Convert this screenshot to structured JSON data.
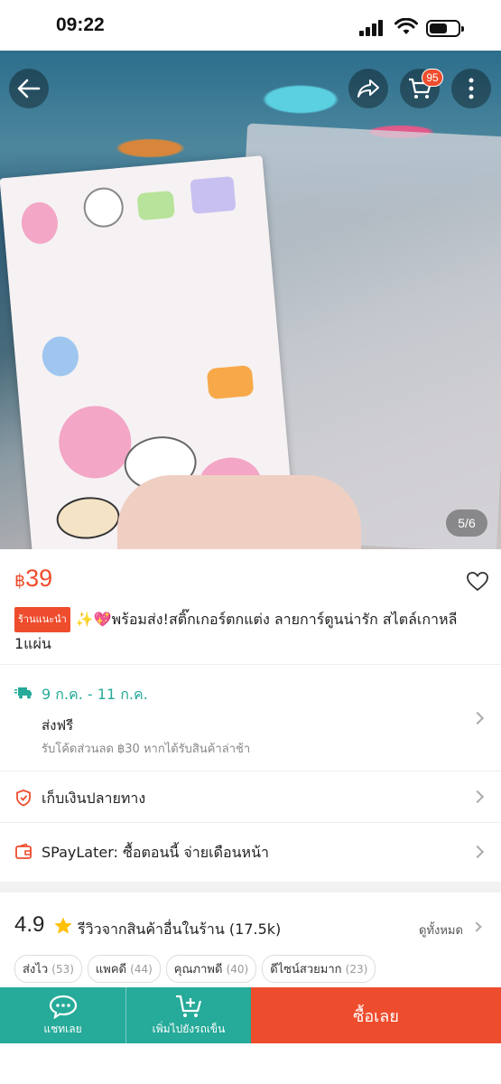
{
  "status_bar": {
    "time": "09:22"
  },
  "hero": {
    "cart_count": "95",
    "counter": "5/6"
  },
  "product": {
    "currency": "฿",
    "price": "39",
    "badge": "ร้านแนะนำ",
    "title": "✨💖พร้อมส่ง!สติ๊กเกอร์ตกแต่ง ลายการ์ตูนน่ารัก สไตล์เกาหลี 1แผ่น"
  },
  "shipping": {
    "date": "9 ก.ค. - 11 ก.ค.",
    "free_label": "ส่งฟรี",
    "note": "รับโค้ดส่วนลด ฿30 หากได้รับสินค้าล่าช้า"
  },
  "payment": {
    "cod": "เก็บเงินปลายทาง",
    "spaylater": "SPayLater: ซื้อตอนนี้ จ่ายเดือนหน้า"
  },
  "reviews": {
    "rating": "4.9",
    "label": "รีวิวจากสินค้าอื่นในร้าน",
    "count": "(17.5k)",
    "see_all": "ดูทั้งหมด",
    "chips": [
      {
        "label": "ส่งไว",
        "count": "(53)"
      },
      {
        "label": "แพคดี",
        "count": "(44)"
      },
      {
        "label": "คุณภาพดี",
        "count": "(40)"
      },
      {
        "label": "ดีไซน์สวยมาก",
        "count": "(23)"
      }
    ]
  },
  "bottom_bar": {
    "chat_label": "แชทเลย",
    "cart_label": "เพิ่มไปยังรถเข็น",
    "buy_label": "ซื้อเลย"
  },
  "colors": {
    "brand": "#ee4d2d",
    "teal": "#26aa99"
  },
  "icons": [
    "back-arrow-icon",
    "share-icon",
    "cart-icon",
    "more-vertical-icon",
    "heart-icon",
    "truck-icon",
    "shield-icon",
    "wallet-icon",
    "star-icon",
    "chat-icon",
    "add-cart-icon",
    "chevron-right-icon"
  ]
}
